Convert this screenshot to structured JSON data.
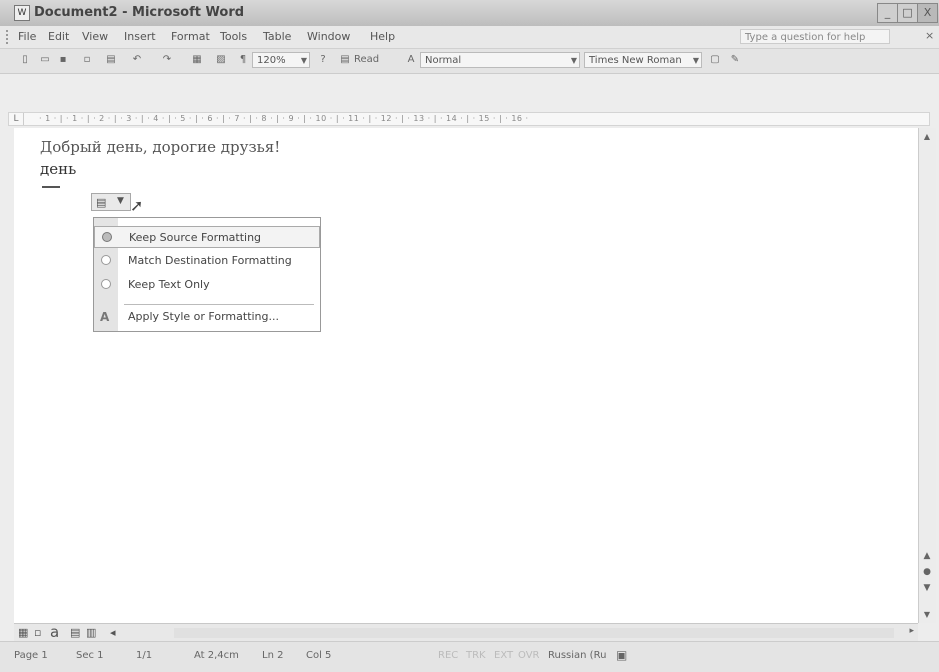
{
  "window": {
    "title": "Document2 - Microsoft Word",
    "controls": [
      "_",
      "□",
      "X"
    ]
  },
  "menu": {
    "items": [
      "File",
      "Edit",
      "View",
      "Insert",
      "Format",
      "Tools",
      "Table",
      "Window",
      "Help"
    ],
    "help_placeholder": "Type a question for help",
    "close_glyph": "× "
  },
  "toolbar": {
    "zoom": "120%",
    "read_label": "Read",
    "style": "Normal",
    "font": "Times New Roman"
  },
  "ruler": {
    "ticks": "· 1 · | · 1 · | · 2 · | · 3 · | · 4 · | · 5 · | · 6 · | · 7 · | · 8 · | · 9 · | · 10 · | · 11 · | · 12 · | · 13 · | · 14 · | · 15 · | · 16 ·"
  },
  "document": {
    "line1": "Добрый день, дорогие друзья!",
    "line2": "день"
  },
  "paste_options": {
    "items": [
      {
        "label": "Keep Source Formatting",
        "selected": true
      },
      {
        "label": "Match Destination Formatting",
        "selected": false
      },
      {
        "label": "Keep Text Only",
        "selected": false
      },
      {
        "label": "Apply Style or Formatting...",
        "selected": false
      }
    ]
  },
  "view_bar": {
    "glyph_a": "a"
  },
  "status": {
    "page": "Page 1",
    "sec": "Sec 1",
    "pages": "1/1",
    "at": "At 2,4cm",
    "ln": "Ln 2",
    "col": "Col 5",
    "rec": "REC",
    "trk": "TRK",
    "ext": "EXT",
    "ovr": "OVR",
    "language": "Russian (Ru"
  }
}
